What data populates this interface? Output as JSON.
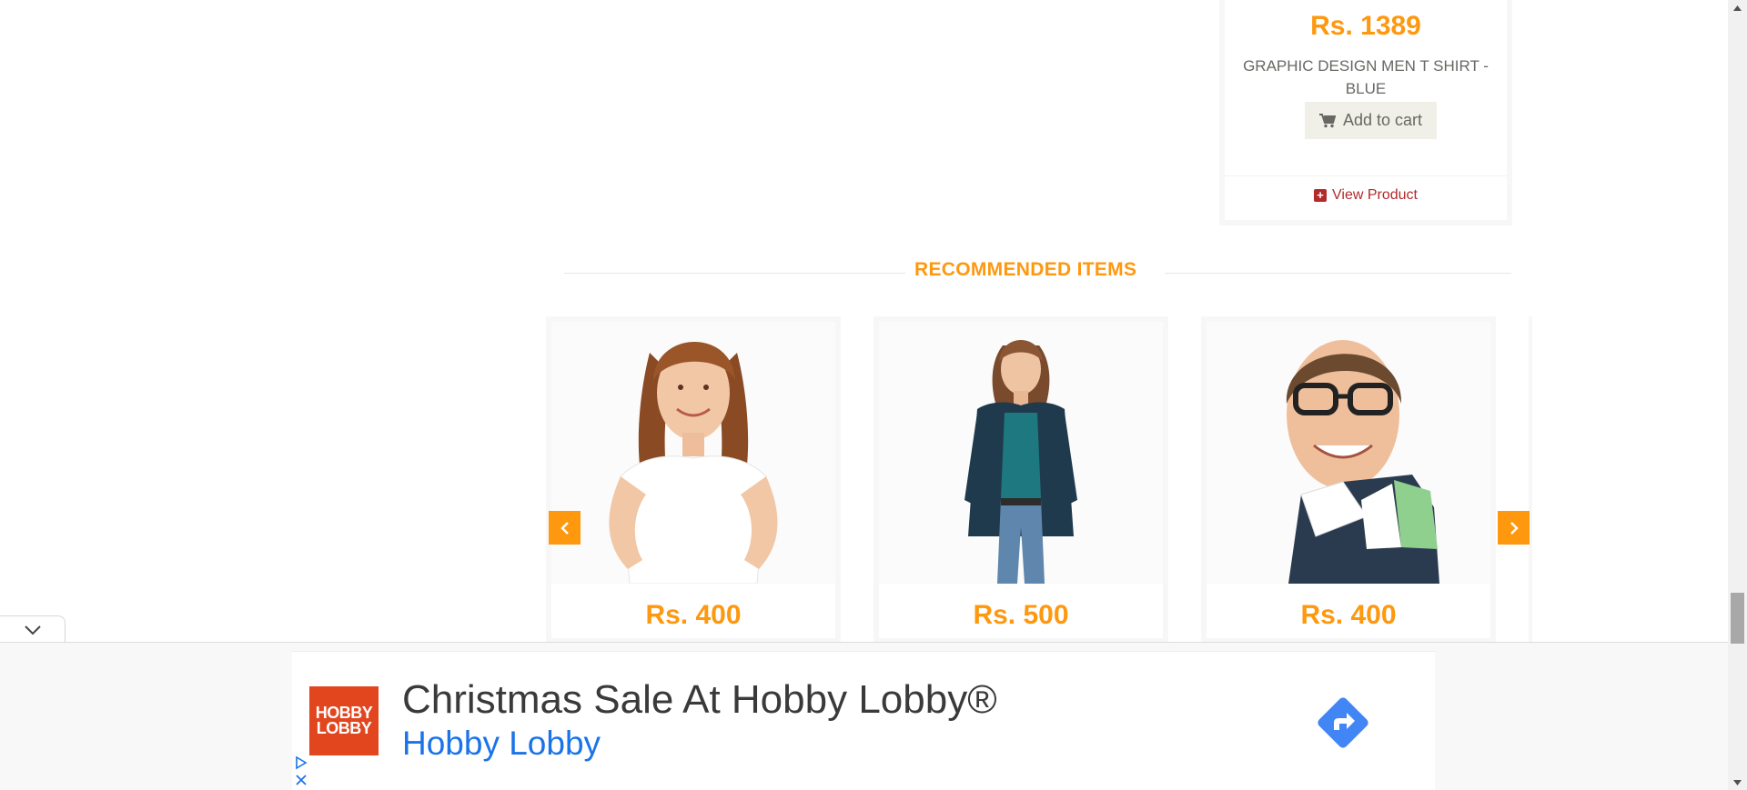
{
  "featured": {
    "price": "Rs. 1389",
    "name": "GRAPHIC DESIGN MEN T SHIRT - BLUE",
    "add_to_cart": "Add to cart",
    "view_product": "View Product"
  },
  "recommended": {
    "title": "RECOMMENDED ITEMS",
    "items": [
      {
        "price": "Rs. 400",
        "image": "woman-white-tshirt"
      },
      {
        "price": "Rs. 500",
        "image": "woman-teal-top-jeans"
      },
      {
        "price": "Rs. 400",
        "image": "man-glasses-polo"
      }
    ]
  },
  "ad": {
    "logo_line1": "HOBBY",
    "logo_line2": "LOBBY",
    "headline": "Christmas Sale At Hobby Lobby®",
    "advertiser": "Hobby Lobby"
  },
  "colors": {
    "accent": "#fe980f",
    "view_product": "#b22a2a",
    "ad_link": "#1a73e8",
    "ad_logo": "#e2461f",
    "ad_go_button": "#4285f4"
  },
  "icons": [
    "shopping-cart-icon",
    "plus-square-icon",
    "chevron-left-icon",
    "chevron-right-icon",
    "chevron-down-icon",
    "ad-choices-icon",
    "close-icon",
    "directions-arrow-icon"
  ]
}
